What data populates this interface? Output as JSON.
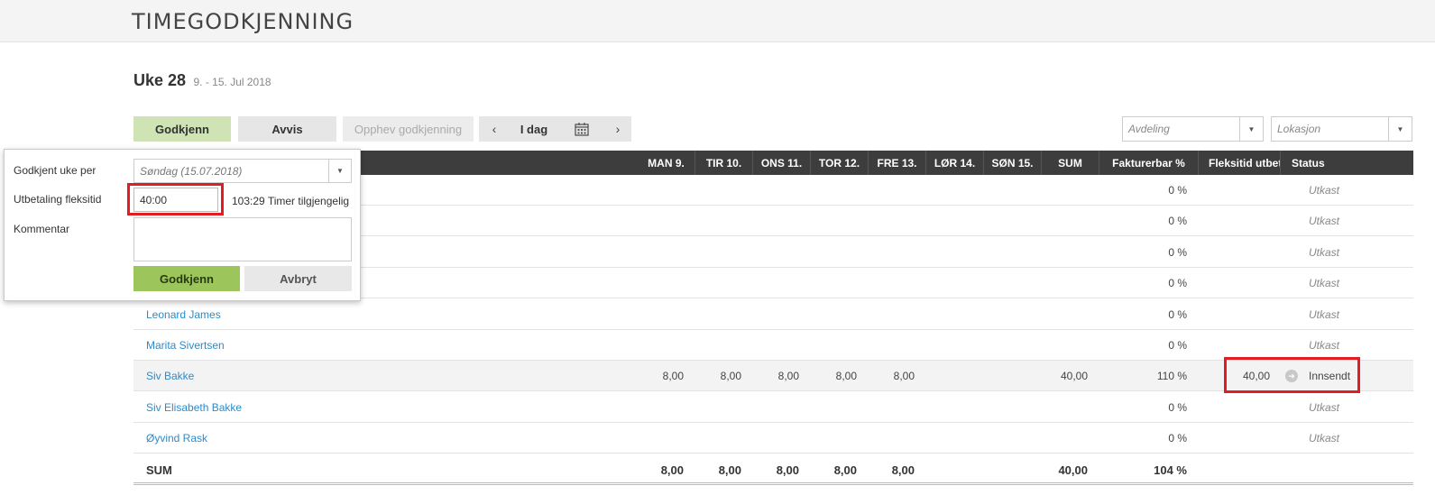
{
  "app_title": "TIMEGODKJENNING",
  "week": {
    "label": "Uke 28",
    "range": "9. - 15. Jul 2018"
  },
  "toolbar": {
    "approve": "Godkjenn",
    "reject": "Avvis",
    "revoke": "Opphev godkjenning",
    "prev": "‹",
    "today": "I dag",
    "next": "›",
    "department_placeholder": "Avdeling",
    "location_placeholder": "Lokasjon"
  },
  "columns": [
    "MAN 9.",
    "TIR 10.",
    "ONS 11.",
    "TOR 12.",
    "FRE 13.",
    "LØR 14.",
    "SØN 15.",
    "SUM",
    "Fakturerbar %",
    "Fleksitid utbet",
    "Status"
  ],
  "rows": [
    {
      "name": "",
      "days": [
        "",
        "",
        "",
        "",
        "",
        "",
        ""
      ],
      "sum": "",
      "billable": "0 %",
      "flex": "",
      "status": "Utkast"
    },
    {
      "name": "",
      "days": [
        "",
        "",
        "",
        "",
        "",
        "",
        ""
      ],
      "sum": "",
      "billable": "0 %",
      "flex": "",
      "status": "Utkast"
    },
    {
      "name": "",
      "days": [
        "",
        "",
        "",
        "",
        "",
        "",
        ""
      ],
      "sum": "",
      "billable": "0 %",
      "flex": "",
      "status": "Utkast"
    },
    {
      "name": "",
      "days": [
        "",
        "",
        "",
        "",
        "",
        "",
        ""
      ],
      "sum": "",
      "billable": "0 %",
      "flex": "",
      "status": "Utkast"
    },
    {
      "name": "Leonard James",
      "days": [
        "",
        "",
        "",
        "",
        "",
        "",
        ""
      ],
      "sum": "",
      "billable": "0 %",
      "flex": "",
      "status": "Utkast"
    },
    {
      "name": "Marita Sivertsen",
      "days": [
        "",
        "",
        "",
        "",
        "",
        "",
        ""
      ],
      "sum": "",
      "billable": "0 %",
      "flex": "",
      "status": "Utkast"
    },
    {
      "name": "Siv Bakke",
      "days": [
        "8,00",
        "8,00",
        "8,00",
        "8,00",
        "8,00",
        "",
        ""
      ],
      "sum": "40,00",
      "billable": "110 %",
      "flex": "40,00",
      "status": "Innsendt"
    },
    {
      "name": "Siv Elisabeth Bakke",
      "days": [
        "",
        "",
        "",
        "",
        "",
        "",
        ""
      ],
      "sum": "",
      "billable": "0 %",
      "flex": "",
      "status": "Utkast"
    },
    {
      "name": "Øyvind Rask",
      "days": [
        "",
        "",
        "",
        "",
        "",
        "",
        ""
      ],
      "sum": "",
      "billable": "0 %",
      "flex": "",
      "status": "Utkast"
    }
  ],
  "totals": {
    "label": "SUM",
    "days": [
      "8,00",
      "8,00",
      "8,00",
      "8,00",
      "8,00",
      "",
      ""
    ],
    "sum": "40,00",
    "billable": "104 %"
  },
  "popup": {
    "approved_per_label": "Godkjent uke per",
    "approved_per_value": "Søndag (15.07.2018)",
    "flex_payout_label": "Utbetaling fleksitid",
    "flex_payout_value": "40:00",
    "available_value": "103:29",
    "available_label": "Timer tilgjengelig",
    "comment_label": "Kommentar",
    "ok": "Godkjenn",
    "cancel": "Avbryt"
  }
}
